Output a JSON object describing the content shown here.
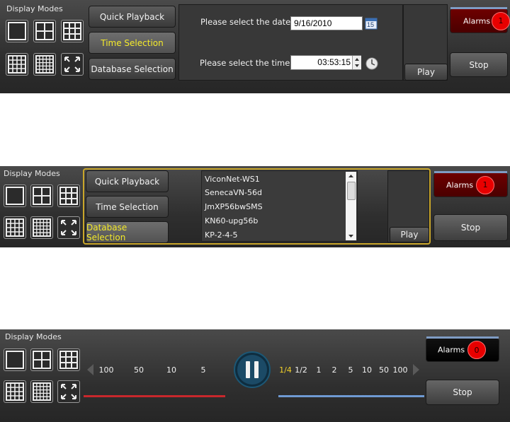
{
  "panel1": {
    "display_modes_label": "Display Modes",
    "modes": [
      "single-view-icon",
      "grid-2x2-icon",
      "grid-3x3-icon",
      "grid-4x4-icon",
      "grid-5x5-icon",
      "fullscreen-icon"
    ],
    "buttons": {
      "quick_playback": "Quick Playback",
      "time_selection": "Time Selection",
      "database_selection": "Database Selection"
    },
    "active": "time_selection",
    "date_label": "Please select the date:",
    "date_value": "9/16/2010",
    "calendar_day": "15",
    "time_label": "Please select the time:",
    "time_value": "03:53:15",
    "play": "Play",
    "alarms": {
      "label": "Alarms",
      "count": "1"
    },
    "stop": "Stop"
  },
  "panel2": {
    "display_modes_label": "Display Modes",
    "buttons": {
      "quick_playback": "Quick Playback",
      "time_selection": "Time Selection",
      "database_selection": "Database Selection"
    },
    "active": "database_selection",
    "list_items": [
      "ViconNet-WS1",
      "SenecaVN-56d",
      "JmXP56bwSMS",
      "KN60-upg56b",
      "KP-2-4-5"
    ],
    "play": "Play",
    "alarms": {
      "label": "Alarms",
      "count": "1"
    },
    "stop": "Stop"
  },
  "panel3": {
    "display_modes_label": "Display Modes",
    "rewind_speeds": [
      "100",
      "50",
      "10",
      "5"
    ],
    "forward_speeds": [
      "1/4",
      "1/2",
      "1",
      "2",
      "5",
      "10",
      "50",
      "100"
    ],
    "selected_forward_speed": "1/4",
    "alarms": {
      "label": "Alarms",
      "count": "0"
    },
    "stop": "Stop"
  },
  "colors": {
    "active_text": "#f4ea2a",
    "alarm_red": "#e80000",
    "rewind_bar": "#c8272c",
    "forward_bar": "#6f9ad3",
    "selected_speed": "#f4d22a"
  }
}
